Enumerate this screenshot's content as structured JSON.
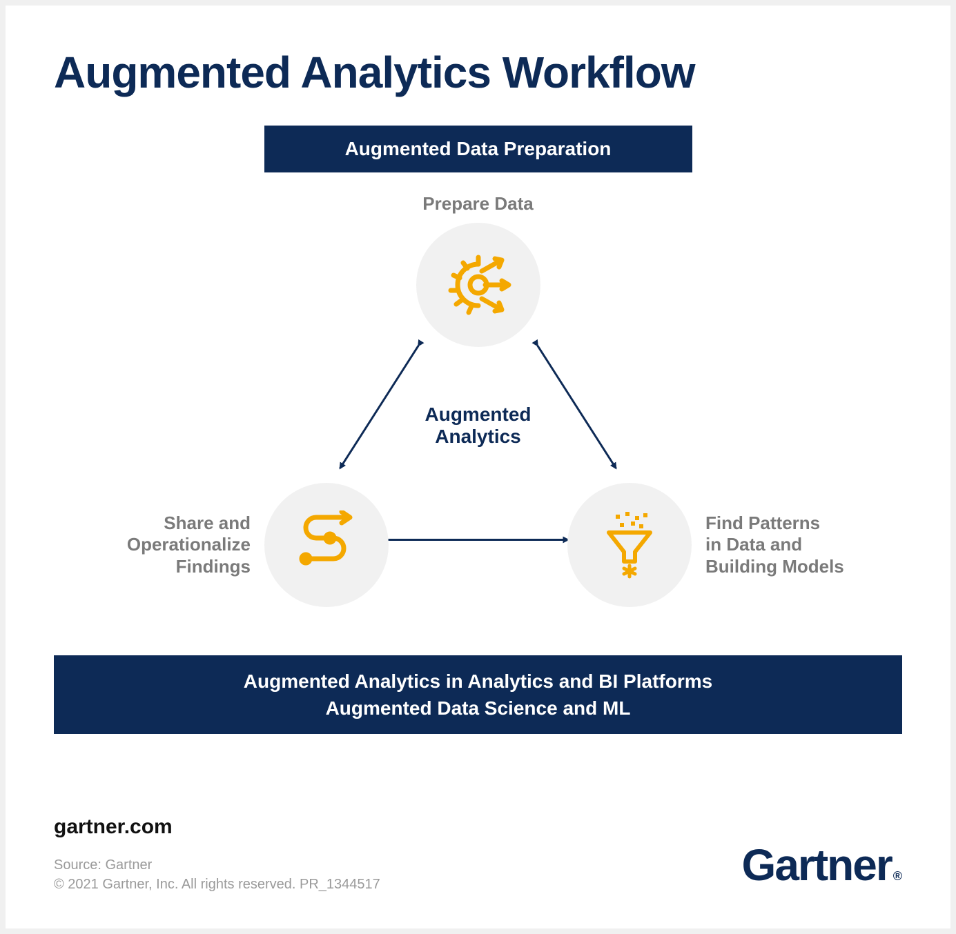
{
  "title": "Augmented Analytics Workflow",
  "banner_top": "Augmented Data Preparation",
  "center_label_1": "Augmented",
  "center_label_2": "Analytics",
  "nodes": {
    "top": {
      "label": "Prepare Data"
    },
    "left": {
      "label_1": "Share and",
      "label_2": "Operationalize",
      "label_3": "Findings"
    },
    "right": {
      "label_1": "Find Patterns",
      "label_2": "in Data and",
      "label_3": "Building Models"
    }
  },
  "banner_bottom_1": "Augmented Analytics in Analytics and BI Platforms",
  "banner_bottom_2": "Augmented Data Science and ML",
  "footer": {
    "url": "gartner.com",
    "source": "Source: Gartner",
    "copyright": "© 2021 Gartner, Inc. All rights reserved. PR_1344517"
  },
  "brand": "Gartner",
  "colors": {
    "accent": "#f4a800",
    "navy": "#0d2a56",
    "grey": "#7a7a7a"
  }
}
